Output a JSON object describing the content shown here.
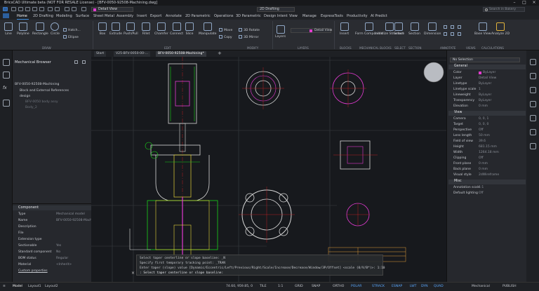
{
  "app": {
    "title": "BricsCAD Ultimate beta (NOT FOR RESALE License) - [BFV-0050-92508-Machining.dwg]",
    "current_layer": "Detail View",
    "workspace": "2D Drafting",
    "search_placeholder": "Search in Bakery"
  },
  "ribbon_tabs": [
    "Home",
    "2D Drafting",
    "Modeling",
    "Surface",
    "Sheet Metal",
    "Assembly",
    "Insert",
    "Export",
    "Annotate",
    "2D Parametric",
    "Operations",
    "3D Parametric",
    "Design Intent",
    "View",
    "Manage",
    "ExpressTools",
    "Productivity",
    "AI Predict"
  ],
  "active_tab": "Home",
  "ribbon": {
    "draw": [
      "Line",
      "Polyline",
      "Rectangle",
      "Circle"
    ],
    "draw_small": [
      "Hatch...",
      "Ellipse"
    ],
    "modeling": [
      "Box",
      "Extrude",
      "Push/Pull",
      "Fillet",
      "Chamfer",
      "Connect",
      "Slice",
      "Manipulate"
    ],
    "modify_small": [
      "Move",
      "3D Rotate",
      "3D Mirror",
      "Copy"
    ],
    "layers_label": "Layers",
    "blocks": [
      "Insert"
    ],
    "mechanical": [
      "Form Component",
      "Initialize Structure"
    ],
    "select": [
      "Select"
    ],
    "section": [
      "Section"
    ],
    "annotate": [
      "Dimension"
    ],
    "views": [
      "Base View"
    ],
    "calculations": [
      "Analyze 2D"
    ],
    "groups": [
      "DRAW",
      "EDIT",
      "MODIFY",
      "LAYERS",
      "BLOCKS",
      "MECHANICAL BLOCKS",
      "SELECT",
      "SECTION",
      "ANNOTATE",
      "VIEWS",
      "CALCULATIONS"
    ]
  },
  "browser": {
    "title": "Mechanical Browser",
    "items": [
      "BFV-0050-92508-Machining",
      "Block and External References",
      "design",
      "BFV-0050 body assy",
      "Body_2"
    ]
  },
  "component": {
    "title": "Component",
    "rows": [
      {
        "k": "Type",
        "v": "Mechanical model"
      },
      {
        "k": "Name",
        "v": "BFV-0050-92508-Machini"
      },
      {
        "k": "Description",
        "v": ""
      },
      {
        "k": "File",
        "v": ""
      },
      {
        "k": "Extension type",
        "v": ""
      },
      {
        "k": "Sectionable",
        "v": "Yes"
      },
      {
        "k": "Standard component",
        "v": "No"
      },
      {
        "k": "BOM status",
        "v": "Regular"
      },
      {
        "k": "Material",
        "v": "<Inherit>"
      }
    ],
    "link": "Custom properties"
  },
  "doc_tabs": [
    "Start",
    "V25-BFV-0050-00-...",
    "BFV-0050-92508-Machining*"
  ],
  "command_lines": [
    "Select taper centerline or slope baseline: _N",
    "Specify first temporary tracking point: _TRAN",
    "Enter taper (slope) value [Dynamic/Eccentric/Left/Previous/Right/Scale/Increase/Decrease/Window/3P/Offset] <scale (0/V/B*)>: 1:10",
    ": Select taper centerline or slope baseline:"
  ],
  "properties": {
    "selector": "No Selection",
    "sections": [
      {
        "title": "General",
        "rows": [
          {
            "k": "Color",
            "v": "ByLayer"
          },
          {
            "k": "Layer",
            "v": "Detail View"
          },
          {
            "k": "Linetype",
            "v": "ByLayer"
          },
          {
            "k": "Linetype scale",
            "v": "1"
          },
          {
            "k": "Lineweight",
            "v": "ByLayer"
          },
          {
            "k": "Transparency",
            "v": "ByLayer"
          },
          {
            "k": "Elevation",
            "v": "0 mm"
          }
        ]
      },
      {
        "title": "View",
        "rows": [
          {
            "k": "Camera",
            "v": "0, 0, 1"
          },
          {
            "k": "Target",
            "v": "0, 0, 0"
          },
          {
            "k": "Perspective",
            "v": "Off"
          },
          {
            "k": "Lens length",
            "v": "50 mm"
          },
          {
            "k": "Field of view",
            "v": "39.6"
          },
          {
            "k": "Height",
            "v": "681.15 mm"
          },
          {
            "k": "Width",
            "v": "1264.18 mm"
          },
          {
            "k": "Clipping",
            "v": "Off"
          },
          {
            "k": "Front plane",
            "v": "0 mm"
          },
          {
            "k": "Back plane",
            "v": "0 mm"
          },
          {
            "k": "Visual style",
            "v": "2dWireframe"
          }
        ]
      },
      {
        "title": "Misc",
        "rows": [
          {
            "k": "Annotation scale",
            "v": "1:1"
          },
          {
            "k": "Default lighting",
            "v": "Off"
          }
        ]
      }
    ],
    "colors": {
      "bylayer": "#e23ccf"
    }
  },
  "status": {
    "layouts": [
      "Model",
      "Layout1",
      "Layout2"
    ],
    "coords": "74.60, 959.85, 0",
    "toggles": [
      "TILE",
      "1:1",
      "GRID",
      "SNAP",
      "ORTHO",
      "POLAR",
      "ESNAP",
      "STRACK",
      "LWT",
      "DYN",
      "QUAD"
    ],
    "active_toggles": [
      "POLAR",
      "ESNAP",
      "STRACK",
      "LWT",
      "DYN",
      "QUAD"
    ],
    "profile": "Mechanical",
    "publish": "PUBLISH"
  }
}
